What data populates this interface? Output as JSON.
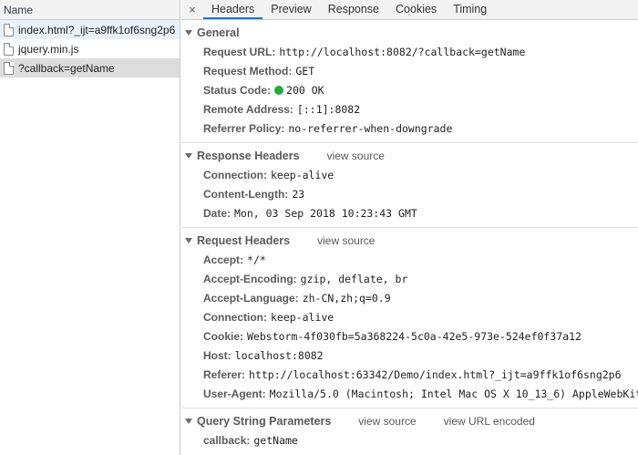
{
  "left": {
    "header": "Name",
    "requests": [
      {
        "name": "index.html?_ijt=a9ffk1of6sng2p6",
        "state": "hover"
      },
      {
        "name": "jquery.min.js",
        "state": ""
      },
      {
        "name": "?callback=getName",
        "state": "selected"
      }
    ]
  },
  "tabs": {
    "close_icon": "×",
    "items": [
      "Headers",
      "Preview",
      "Response",
      "Cookies",
      "Timing"
    ],
    "active": "Headers"
  },
  "general": {
    "title": "General",
    "rows": [
      {
        "key": "Request URL:",
        "value": "http://localhost:8082/?callback=getName"
      },
      {
        "key": "Request Method:",
        "value": "GET"
      },
      {
        "key": "Status Code:",
        "value": "200 OK",
        "status_color": "#1fae3a"
      },
      {
        "key": "Remote Address:",
        "value": "[::1]:8082"
      },
      {
        "key": "Referrer Policy:",
        "value": "no-referrer-when-downgrade"
      }
    ]
  },
  "response_headers": {
    "title": "Response Headers",
    "view_source": "view source",
    "rows": [
      {
        "key": "Connection:",
        "value": "keep-alive"
      },
      {
        "key": "Content-Length:",
        "value": "23"
      },
      {
        "key": "Date:",
        "value": "Mon, 03 Sep 2018 10:23:43 GMT"
      }
    ]
  },
  "request_headers": {
    "title": "Request Headers",
    "view_source": "view source",
    "rows": [
      {
        "key": "Accept:",
        "value": "*/*"
      },
      {
        "key": "Accept-Encoding:",
        "value": "gzip, deflate, br"
      },
      {
        "key": "Accept-Language:",
        "value": "zh-CN,zh;q=0.9"
      },
      {
        "key": "Connection:",
        "value": "keep-alive"
      },
      {
        "key": "Cookie:",
        "value": "Webstorm-4f030fb=5a368224-5c0a-42e5-973e-524ef0f37a12"
      },
      {
        "key": "Host:",
        "value": "localhost:8082"
      },
      {
        "key": "Referer:",
        "value": "http://localhost:63342/Demo/index.html?_ijt=a9ffk1of6sng2p6"
      },
      {
        "key": "User-Agent:",
        "value": "Mozilla/5.0 (Macintosh; Intel Mac OS X 10_13_6) AppleWebKit"
      }
    ]
  },
  "query_string": {
    "title": "Query String Parameters",
    "view_source": "view source",
    "view_url_encoded": "view URL encoded",
    "rows": [
      {
        "key": "callback:",
        "value": "getName"
      }
    ]
  }
}
